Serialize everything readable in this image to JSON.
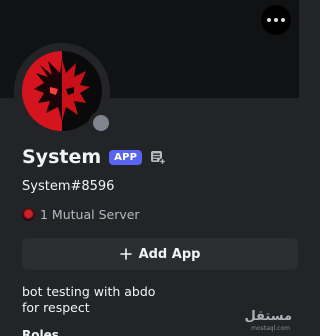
{
  "profile": {
    "display_name": "System",
    "app_badge": "APP",
    "username": "System#8596",
    "mutual_servers": "1 Mutual Server",
    "add_app_label": "Add App",
    "bio_line1": "bot testing with abdo",
    "bio_line2": "for respect",
    "section_heading": "Roles",
    "status": "offline"
  },
  "watermark": {
    "main": "مستقل",
    "sub": "mostaql.com"
  },
  "colors": {
    "card_background": "#232428",
    "banner": "#111214",
    "app_badge": "#5865f2",
    "offline_status": "#80848e",
    "button_background": "#2b2d31",
    "avatar_red": "#d4141e"
  },
  "icons": {
    "more": "more-options-icon",
    "app_directory": "app-directory-icon",
    "plus": "plus-icon",
    "server": "server-icon"
  }
}
